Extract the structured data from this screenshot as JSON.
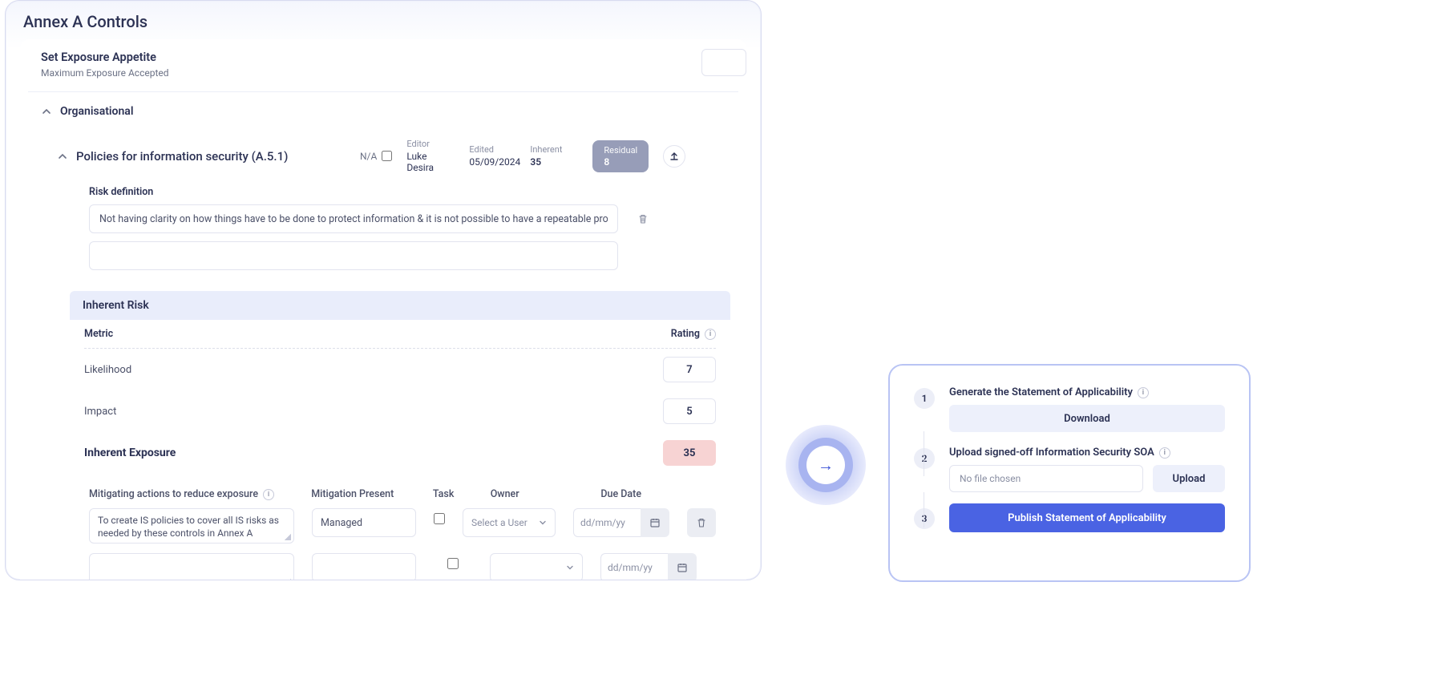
{
  "header": {
    "title": "Annex A Controls"
  },
  "exposure": {
    "title": "Set Exposure Appetite",
    "subtitle": "Maximum Exposure Accepted"
  },
  "section": {
    "name": "Organisational"
  },
  "control": {
    "title": "Policies for information security (A.5.1)",
    "na_label": "N/A",
    "editor_label": "Editor",
    "editor_value": "Luke Desira",
    "edited_label": "Edited",
    "edited_value": "05/09/2024",
    "inherent_label": "Inherent",
    "inherent_value": "35",
    "residual_label": "Residual",
    "residual_value": "8"
  },
  "risk_def": {
    "label": "Risk definition",
    "value": "Not having clarity on how things have to be done to protect information & it is not possible to have a repeatable process with c"
  },
  "inherent_risk": {
    "band": "Inherent Risk",
    "metric_label": "Metric",
    "rating_label": "Rating",
    "likelihood_label": "Likelihood",
    "likelihood_value": "7",
    "impact_label": "Impact",
    "impact_value": "5",
    "exposure_label": "Inherent Exposure",
    "exposure_value": "35"
  },
  "actions": {
    "h_mitigating": "Mitigating actions to reduce exposure",
    "h_present": "Mitigation Present",
    "h_task": "Task",
    "h_owner": "Owner",
    "h_due": "Due Date",
    "row1_text": "To create IS policies to cover all IS risks as needed by these controls in Annex A",
    "row1_present": "Managed",
    "owner_placeholder": "Select a User",
    "date_placeholder": "dd/mm/yy"
  },
  "soa": {
    "s1_title": "Generate the Statement of Applicability",
    "download": "Download",
    "s2_title": "Upload signed-off Information Security SOA",
    "no_file": "No file chosen",
    "upload": "Upload",
    "publish": "Publish Statement of Applicability"
  }
}
